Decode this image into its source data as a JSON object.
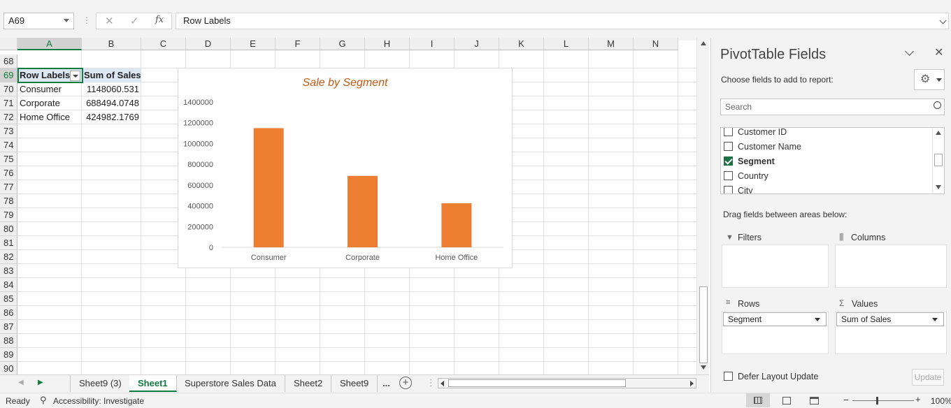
{
  "formula_bar": {
    "name_box": "A69",
    "fx_label": "fx",
    "content": "Row Labels"
  },
  "columns": [
    "A",
    "B",
    "C",
    "D",
    "E",
    "F",
    "G",
    "H",
    "I",
    "J",
    "K",
    "L",
    "M",
    "N"
  ],
  "rows": [
    "68",
    "69",
    "70",
    "71",
    "72",
    "73",
    "74",
    "75",
    "76",
    "77",
    "78",
    "79",
    "80",
    "81",
    "82",
    "83",
    "84",
    "85",
    "86",
    "87",
    "88",
    "89",
    "90"
  ],
  "pivot_table": {
    "headers": [
      "Row Labels",
      "Sum of Sales"
    ],
    "rows": [
      {
        "label": "Consumer",
        "value": "1148060.531"
      },
      {
        "label": "Corporate",
        "value": "688494.0748"
      },
      {
        "label": "Home Office",
        "value": "424982.1769"
      }
    ]
  },
  "chart_data": {
    "type": "bar",
    "title": "Sale by Segment",
    "categories": [
      "Consumer",
      "Corporate",
      "Home Office"
    ],
    "values": [
      1148060.531,
      688494.0748,
      424982.1769
    ],
    "ylim": [
      0,
      1400000
    ],
    "yticks": [
      "0",
      "200000",
      "400000",
      "600000",
      "800000",
      "1000000",
      "1200000",
      "1400000"
    ],
    "bar_color": "#ed7d31",
    "title_color": "#c55a11",
    "grid": false,
    "legend": "none"
  },
  "sheet_tabs": [
    "Sheet9 (3)",
    "Sheet1",
    "Superstore Sales Data",
    "Sheet2",
    "Sheet9"
  ],
  "active_tab": "Sheet1",
  "tab_more": "...",
  "status": {
    "ready": "Ready",
    "accessibility": "Accessibility: Investigate",
    "zoom": "100%"
  },
  "pivot_pane": {
    "title": "PivotTable Fields",
    "choose_label": "Choose fields to add to report:",
    "search_placeholder": "Search",
    "fields": [
      {
        "name": "Customer ID",
        "checked": false
      },
      {
        "name": "Customer Name",
        "checked": false
      },
      {
        "name": "Segment",
        "checked": true
      },
      {
        "name": "Country",
        "checked": false
      },
      {
        "name": "City",
        "checked": false
      }
    ],
    "drag_label": "Drag fields between areas below:",
    "areas": {
      "filters": "Filters",
      "columns": "Columns",
      "rows": "Rows",
      "values": "Values",
      "rows_item": "Segment",
      "values_item": "Sum of Sales"
    },
    "defer_label": "Defer Layout Update",
    "update_label": "Update"
  },
  "colors": {
    "accent": "#107c41",
    "header_fill": "#dde6f3"
  }
}
